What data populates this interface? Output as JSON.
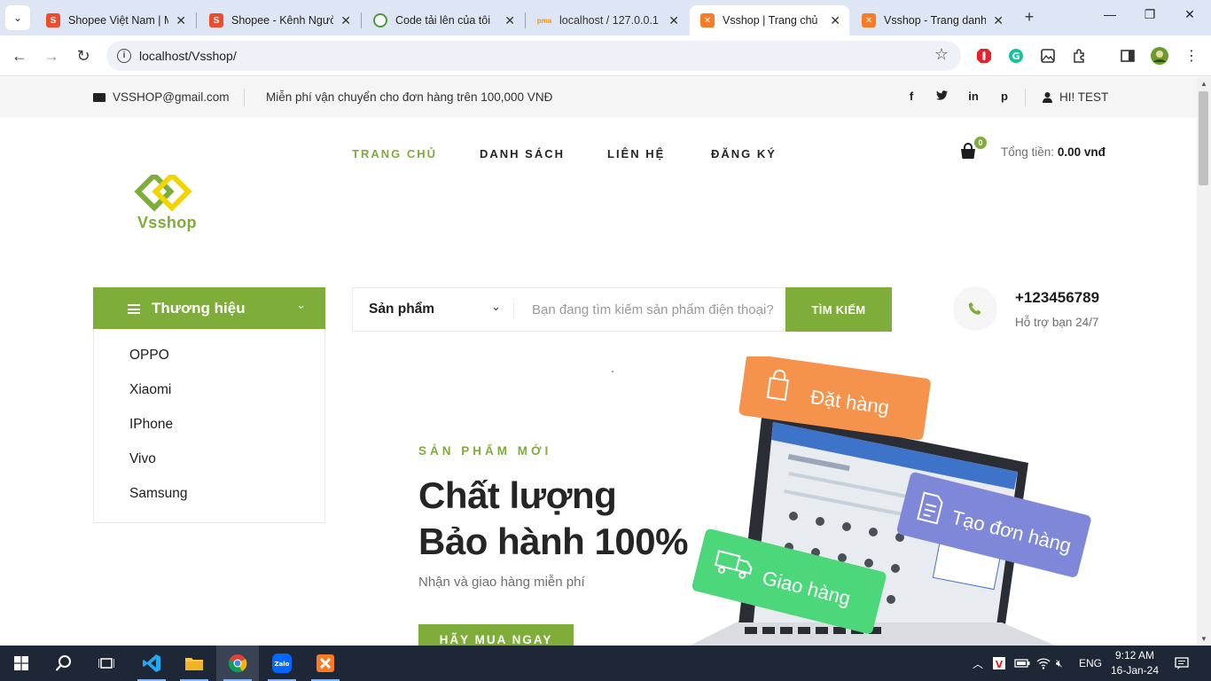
{
  "browser": {
    "tabs": [
      {
        "title": "Shopee Việt Nam | M",
        "favicon": "shopee-icon",
        "color": "#ee4d2d"
      },
      {
        "title": "Shopee - Kênh Người",
        "favicon": "shopee-icon",
        "color": "#ee4d2d"
      },
      {
        "title": "Code tải lên của tôi",
        "favicon": "code-icon",
        "color": "#4a9a3a"
      },
      {
        "title": "localhost / 127.0.0.1 /",
        "favicon": "phpmyadmin-icon",
        "color": "#f29111"
      },
      {
        "title": "Vsshop | Trang chủ",
        "favicon": "xampp-icon",
        "color": "#fb7a24",
        "active": true
      },
      {
        "title": "Vsshop - Trang danh",
        "favicon": "xampp-icon",
        "color": "#fb7a24"
      }
    ],
    "url": "localhost/Vsshop/"
  },
  "topbar": {
    "email": "VSSHOP@gmail.com",
    "shipping": "Miễn phí vận chuyển cho đơn hàng trên 100,000 VNĐ",
    "social": [
      "f",
      "t",
      "in",
      "p"
    ],
    "user": "HI! TEST"
  },
  "header": {
    "logo_text": "Vsshop",
    "nav": [
      "TRANG CHỦ",
      "DANH SÁCH",
      "LIÊN HỆ",
      "ĐĂNG KÝ"
    ],
    "cart_count": "0",
    "total_label": "Tổng tiền:",
    "total_value": "0.00 vnđ"
  },
  "categories": {
    "title": "Thương hiệu",
    "items": [
      "OPPO",
      "Xiaomi",
      "IPhone",
      "Vivo",
      "Samsung"
    ]
  },
  "search": {
    "category": "Sản phẩm",
    "placeholder": "Bạn đang tìm kiếm sản phẩm điện thoại?",
    "button": "TÌM KIẾM"
  },
  "phone": {
    "number": "+123456789",
    "support": "Hỗ trợ bạn 24/7"
  },
  "hero": {
    "tag": "SẢN PHẨM MỚI",
    "title_line1": "Chất lượng",
    "title_line2": "Bảo hành 100%",
    "subtitle": "Nhận và giao hàng miễn phí",
    "button": "HÃY MUA NGAY",
    "badges": [
      "Đặt hàng",
      "Giao hàng",
      "Tạo đơn hàng"
    ]
  },
  "taskbar": {
    "language": "ENG",
    "time": "9:12 AM",
    "date": "16-Jan-24"
  },
  "colors": {
    "accent": "#7fad39",
    "dark": "#1c1c1c",
    "badge_orange": "#f5924b",
    "badge_green": "#4cd77a",
    "badge_purple": "#7f87d9"
  }
}
